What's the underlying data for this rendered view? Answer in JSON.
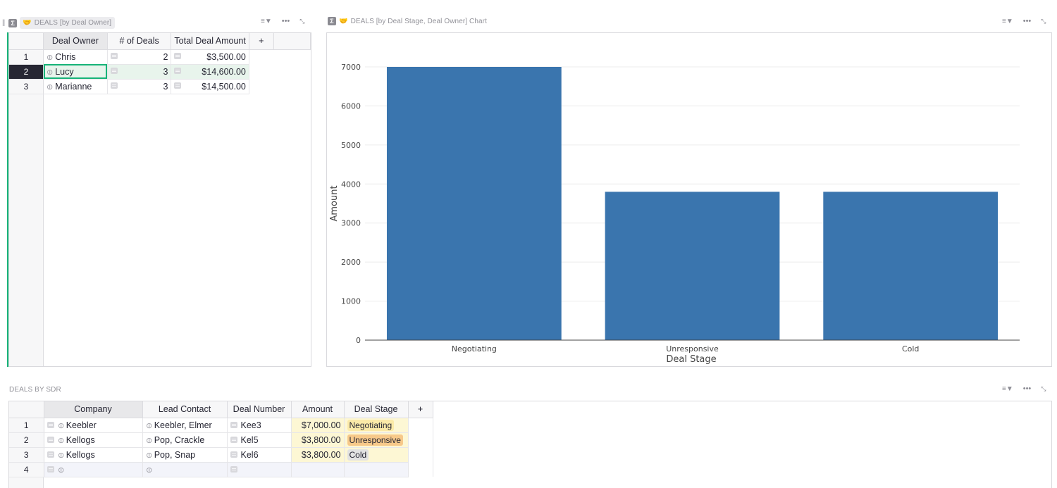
{
  "left_widget": {
    "title": "DEALS [by Deal Owner]",
    "columns": [
      "Deal Owner",
      "# of Deals",
      "Total Deal Amount",
      "+"
    ],
    "rows": [
      {
        "num": "1",
        "owner": "Chris",
        "deals": "2",
        "amount": "$3,500.00"
      },
      {
        "num": "2",
        "owner": "Lucy",
        "deals": "3",
        "amount": "$14,600.00"
      },
      {
        "num": "3",
        "owner": "Marianne",
        "deals": "3",
        "amount": "$14,500.00"
      }
    ]
  },
  "chart_widget": {
    "title": "DEALS [by Deal Stage, Deal Owner] Chart"
  },
  "chart_data": {
    "type": "bar",
    "categories": [
      "Negotiating",
      "Unresponsive",
      "Cold"
    ],
    "values": [
      7000,
      3800,
      3800
    ],
    "title": "",
    "xlabel": "Deal Stage",
    "ylabel": "Amount",
    "ylim": [
      0,
      7000
    ],
    "yticks": [
      0,
      1000,
      2000,
      3000,
      4000,
      5000,
      6000,
      7000
    ],
    "bar_color": "#3a75ae",
    "grid": true
  },
  "bottom_widget": {
    "title": "DEALS BY SDR",
    "columns": [
      "Company",
      "Lead Contact",
      "Deal Number",
      "Amount",
      "Deal Stage",
      "+"
    ],
    "rows": [
      {
        "num": "1",
        "company": "Keebler",
        "contact": "Keebler, Elmer",
        "deal_number": "Kee3",
        "amount": "$7,000.00",
        "stage": "Negotiating",
        "stage_color": "#fbeaa8"
      },
      {
        "num": "2",
        "company": "Kellogs",
        "contact": "Pop, Crackle",
        "deal_number": "Kel5",
        "amount": "$3,800.00",
        "stage": "Unresponsive",
        "stage_color": "#f7c98a"
      },
      {
        "num": "3",
        "company": "Kellogs",
        "contact": "Pop, Snap",
        "deal_number": "Kel6",
        "amount": "$3,800.00",
        "stage": "Cold",
        "stage_color": "#e2e2e2"
      },
      {
        "num": "4",
        "company": "",
        "contact": "",
        "deal_number": "",
        "amount": "",
        "stage": ""
      }
    ]
  },
  "colors": {
    "accent_green": "#16b378",
    "bar_blue": "#3a75ae",
    "amount_bg": "#fdf7d4"
  },
  "icons": [
    "grip-icon",
    "sigma-icon",
    "handshake-icon",
    "sort-filter-icon",
    "more-icon",
    "expand-icon",
    "link-icon",
    "reference-icon"
  ]
}
